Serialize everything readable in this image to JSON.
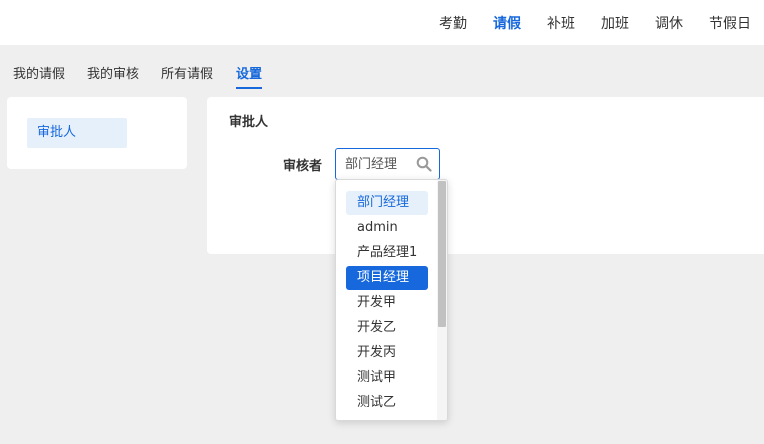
{
  "topnav": {
    "items": [
      {
        "label": "考勤",
        "active": false
      },
      {
        "label": "请假",
        "active": true
      },
      {
        "label": "补班",
        "active": false
      },
      {
        "label": "加班",
        "active": false
      },
      {
        "label": "调休",
        "active": false
      },
      {
        "label": "节假日",
        "active": false
      }
    ]
  },
  "subtabs": {
    "items": [
      {
        "label": "我的请假",
        "active": false
      },
      {
        "label": "我的审核",
        "active": false
      },
      {
        "label": "所有请假",
        "active": false
      },
      {
        "label": "设置",
        "active": true
      }
    ]
  },
  "sidebar": {
    "items": [
      {
        "label": "审批人",
        "active": true
      }
    ]
  },
  "settings": {
    "section_title": "审批人",
    "approver_label": "审核者",
    "approver_placeholder": "部门经理"
  },
  "dropdown": {
    "options": [
      {
        "label": "部门经理",
        "state": "hover"
      },
      {
        "label": "admin",
        "state": ""
      },
      {
        "label": "产品经理1",
        "state": ""
      },
      {
        "label": "项目经理",
        "state": "selected"
      },
      {
        "label": "开发甲",
        "state": ""
      },
      {
        "label": "开发乙",
        "state": ""
      },
      {
        "label": "开发丙",
        "state": ""
      },
      {
        "label": "测试甲",
        "state": ""
      },
      {
        "label": "测试乙",
        "state": ""
      }
    ]
  },
  "colors": {
    "accent": "#1668dc",
    "hover_bg": "#e6f0fb",
    "page_bg": "#efefef"
  }
}
